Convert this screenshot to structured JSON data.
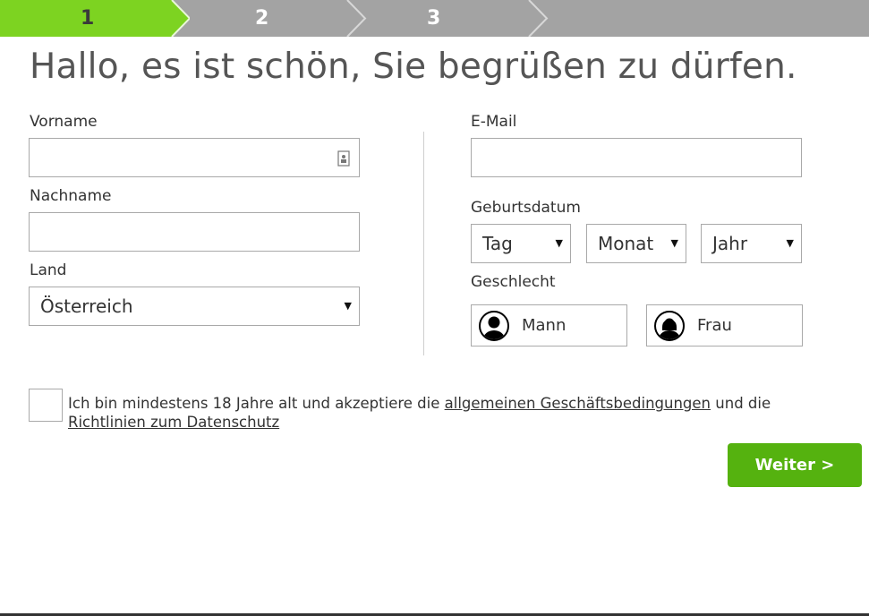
{
  "steps": [
    {
      "number": "1",
      "state": "active"
    },
    {
      "number": "2",
      "state": "inactive"
    },
    {
      "number": "3",
      "state": "inactive"
    }
  ],
  "colors": {
    "accent_green": "#55b20f",
    "step_active": "#7dd321",
    "step_bar": "#a3a3a3",
    "border": "#a9a9a9"
  },
  "header": {
    "title": "Hallo, es ist schön, Sie begrüßen zu dürfen."
  },
  "form": {
    "first_name": {
      "label": "Vorname",
      "value": "",
      "placeholder": ""
    },
    "last_name": {
      "label": "Nachname",
      "value": "",
      "placeholder": ""
    },
    "country": {
      "label": "Land",
      "selected": "Österreich"
    },
    "email": {
      "label": "E-Mail",
      "value": "",
      "placeholder": ""
    },
    "birthdate": {
      "label": "Geburtsdatum",
      "day": "Tag",
      "month": "Monat",
      "year": "Jahr"
    },
    "gender": {
      "label": "Geschlecht",
      "male": "Mann",
      "female": "Frau"
    }
  },
  "terms": {
    "prefix": "Ich bin mindestens 18 Jahre alt und akzeptiere die ",
    "link_terms": "allgemeinen Geschäftsbedingungen",
    "middle": " und die ",
    "link_privacy": "Richtlinien zum Datenschutz"
  },
  "actions": {
    "next_label": "Weiter >"
  },
  "icons": {
    "autofill": "contact-card-icon",
    "dropdown": "caret-down-icon",
    "gender": "person-silhouette-icon",
    "step_separator": "chevron-right-icon"
  }
}
